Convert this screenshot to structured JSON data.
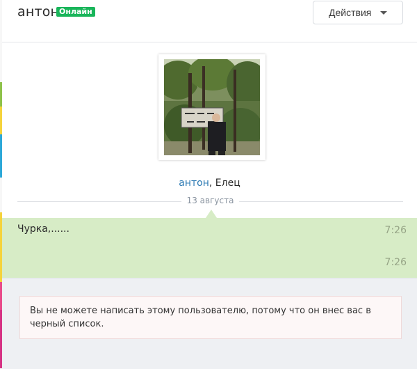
{
  "header": {
    "user_name": "антон",
    "online_badge": "Онлайн",
    "actions_label": "Действия"
  },
  "profile": {
    "name": "антон",
    "separator": ", ",
    "city": "Елец"
  },
  "date_divider": "13 августа",
  "messages": [
    {
      "text": "Чурка,......",
      "time": "7:26"
    },
    {
      "text": "",
      "time": "7:26"
    }
  ],
  "blocked_notice": "Вы не можете написать этому пользователю, потому что он внес вас в черный список.",
  "colors": {
    "accent": "#2b79b3",
    "online": "#19b55a",
    "message_bg": "#d7ecc6",
    "footer_bg": "#eef0f3"
  }
}
